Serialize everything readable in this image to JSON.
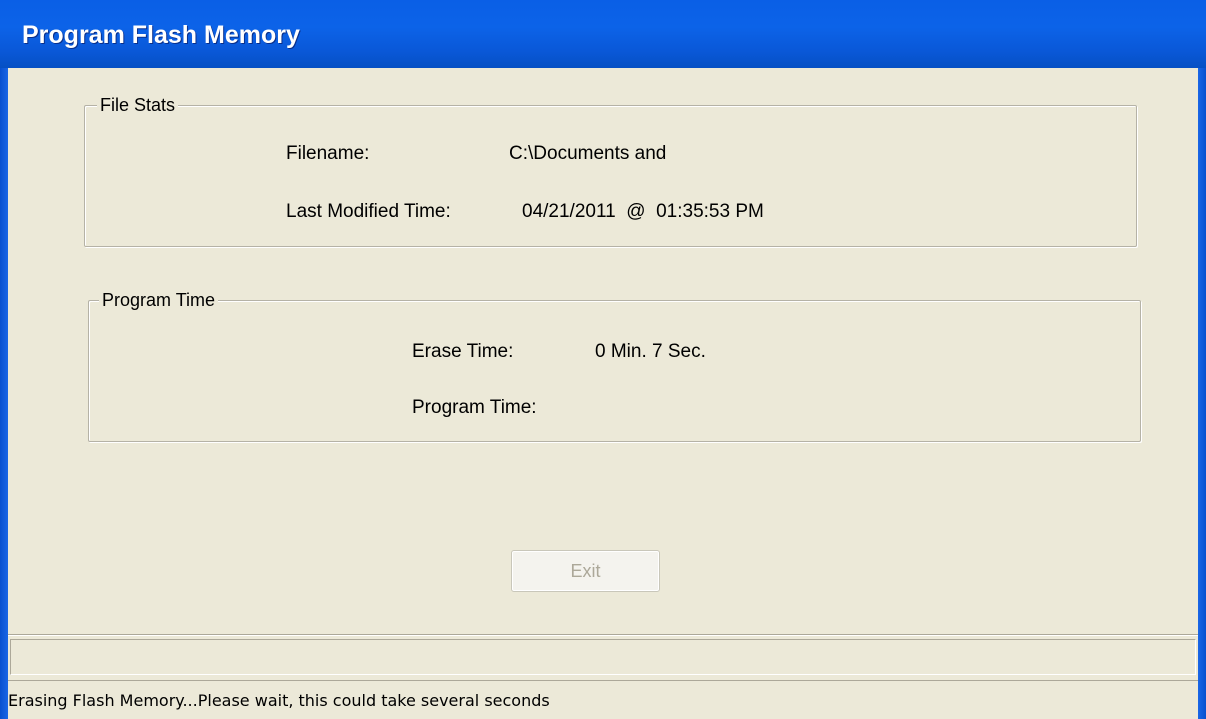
{
  "window": {
    "title": "Program Flash Memory"
  },
  "file_stats": {
    "legend": "File Stats",
    "filename_label": "Filename:",
    "filename_value": "C:\\Documents and",
    "modified_label": "Last Modified Time:",
    "modified_value": "04/21/2011  @  01:35:53 PM"
  },
  "program_time": {
    "legend": "Program Time",
    "erase_label": "Erase Time:",
    "erase_value": "0 Min. 7 Sec.",
    "program_label": "Program Time:",
    "program_value": ""
  },
  "buttons": {
    "exit_label": "Exit",
    "exit_enabled": false
  },
  "status_bar": {
    "text": "Erasing Flash Memory...Please wait, this could take several seconds"
  },
  "colors": {
    "titlebar": "#0a5fe6",
    "dialog_background": "#ece9d8",
    "disabled_text": "#aca899"
  }
}
